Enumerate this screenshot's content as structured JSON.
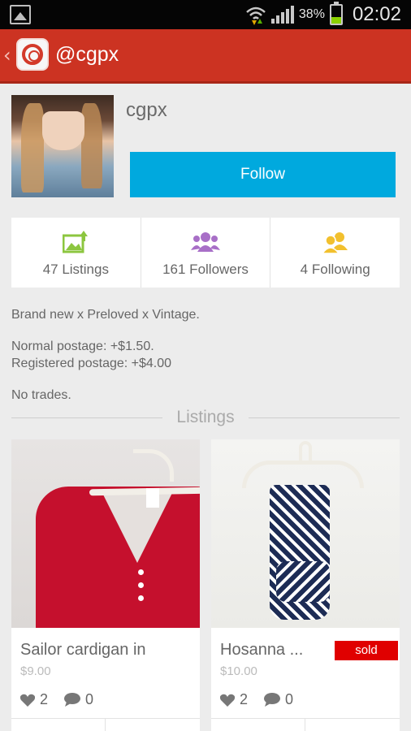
{
  "status_bar": {
    "battery": "38%",
    "battery_level": 0.38,
    "time": "02:02"
  },
  "app_bar": {
    "title": "@cgpx"
  },
  "profile": {
    "username": "cgpx",
    "follow_label": "Follow"
  },
  "stats": [
    {
      "label": "47 Listings",
      "icon": "listings-upload-icon",
      "color": "#8cc63f"
    },
    {
      "label": "161 Followers",
      "icon": "followers-group-icon",
      "color": "#a86fc7"
    },
    {
      "label": "4 Following",
      "icon": "following-pair-icon",
      "color": "#f2c02e"
    }
  ],
  "bio": {
    "line1": "Brand new x Preloved x Vintage.",
    "line2": "Normal postage: +$1.50.",
    "line3": "Registered postage: +$4.00",
    "line4": "No trades."
  },
  "section_title": "Listings",
  "listings": [
    {
      "name": "Sailor cardigan in",
      "price": "$9.00",
      "likes": "2",
      "comments": "0"
    },
    {
      "name": "Hosanna ...",
      "price": "$10.00",
      "likes": "2",
      "comments": "0",
      "badge": "sold"
    }
  ],
  "colors": {
    "app_bar": "#cc3322",
    "follow_button": "#00a9de",
    "sold_badge": "#e00000"
  }
}
